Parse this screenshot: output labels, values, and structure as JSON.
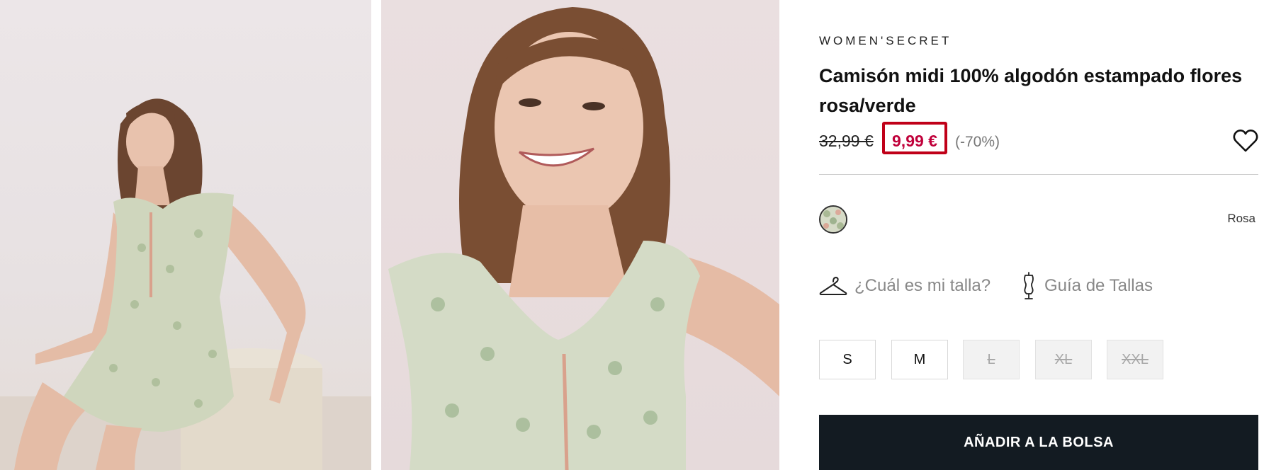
{
  "product": {
    "brand": "WOMEN'SECRET",
    "title": "Camisón midi 100% algodón estampado flores rosa/verde",
    "old_price": "32,99 €",
    "new_price": "9,99 €",
    "discount": "(-70%)"
  },
  "color": {
    "selected_label": "Rosa"
  },
  "help": {
    "fit_label": "¿Cuál es mi talla?",
    "guide_label": "Guía de Tallas"
  },
  "sizes": [
    {
      "label": "S",
      "available": true
    },
    {
      "label": "M",
      "available": true
    },
    {
      "label": "L",
      "available": false
    },
    {
      "label": "XL",
      "available": false
    },
    {
      "label": "XXL",
      "available": false
    }
  ],
  "cta": {
    "add_to_bag": "AÑADIR A LA BOLSA"
  },
  "colors": {
    "price_highlight": "#c00018",
    "sale_price": "#c0003a",
    "button_bg": "#131b22"
  },
  "icons": {
    "wishlist": "heart-icon",
    "fit": "hanger-icon",
    "guide": "mannequin-icon"
  }
}
